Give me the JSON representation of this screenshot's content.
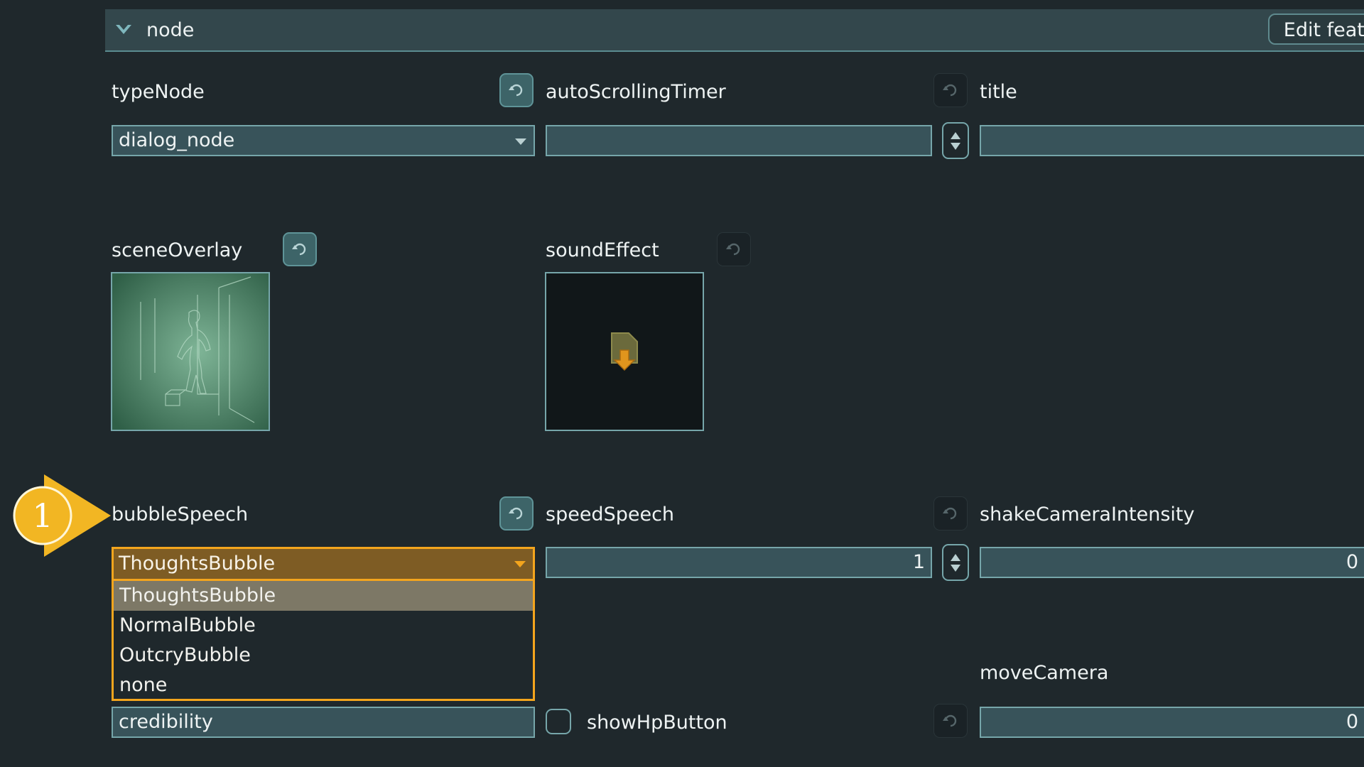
{
  "header": {
    "title": "node",
    "edit_button": "Edit featu"
  },
  "fields": {
    "typeNode": {
      "label": "typeNode",
      "value": "dialog_node"
    },
    "autoScrollingTimer": {
      "label": "autoScrollingTimer",
      "value": ""
    },
    "title": {
      "label": "title",
      "value": ""
    },
    "sceneOverlay": {
      "label": "sceneOverlay"
    },
    "soundEffect": {
      "label": "soundEffect"
    },
    "bubbleSpeech": {
      "label": "bubbleSpeech",
      "value": "ThoughtsBubble",
      "options": [
        "ThoughtsBubble",
        "NormalBubble",
        "OutcryBubble",
        "none"
      ]
    },
    "speedSpeech": {
      "label": "speedSpeech",
      "value": "1"
    },
    "shakeCameraIntensity": {
      "label": "shakeCameraIntensity",
      "value": "0"
    },
    "moveCamera": {
      "label": "moveCamera",
      "value": "0"
    },
    "credibility": {
      "value": "credibility"
    },
    "showHpButton": {
      "label": "showHpButton"
    }
  },
  "callout": {
    "number": "1",
    "color": "#f2b623"
  },
  "colors": {
    "accent": "#f4a51d",
    "field_border": "#76a6aa",
    "background": "#1f282c"
  }
}
